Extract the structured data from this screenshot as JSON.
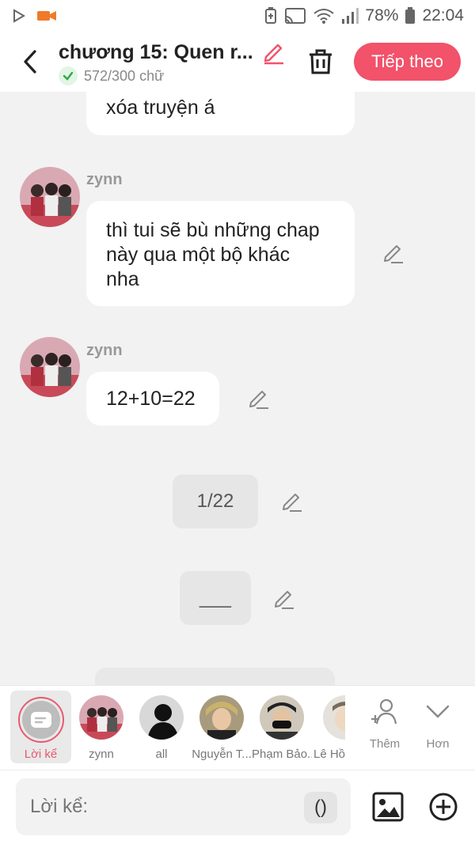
{
  "status_bar": {
    "battery": "78%",
    "time": "22:04"
  },
  "header": {
    "title": "chương 15: Quen r...",
    "word_count": "572/300 chữ",
    "next_label": "Tiếp theo",
    "accent": "#f2526a"
  },
  "messages": [
    {
      "text": "xóa truyện á"
    },
    {
      "author": "zynn",
      "lines": [
        "thì tui sẽ bù những chap",
        "này qua một bộ khác",
        "nha"
      ]
    },
    {
      "author": "zynn",
      "text": "12+10=22"
    },
    {
      "text": "1/22"
    },
    {
      "text": "___"
    }
  ],
  "characters": {
    "narrator_label": "Lời kể",
    "items": [
      {
        "label": "zynn"
      },
      {
        "label": "all"
      },
      {
        "label": "Nguyễn T..."
      },
      {
        "label": "Phạm Bảo..."
      },
      {
        "label": "Lê Hồ"
      }
    ],
    "add_label": "Thêm",
    "more_label": "Hơn"
  },
  "input": {
    "placeholder": "Lời kể:",
    "paren_label": "()"
  }
}
